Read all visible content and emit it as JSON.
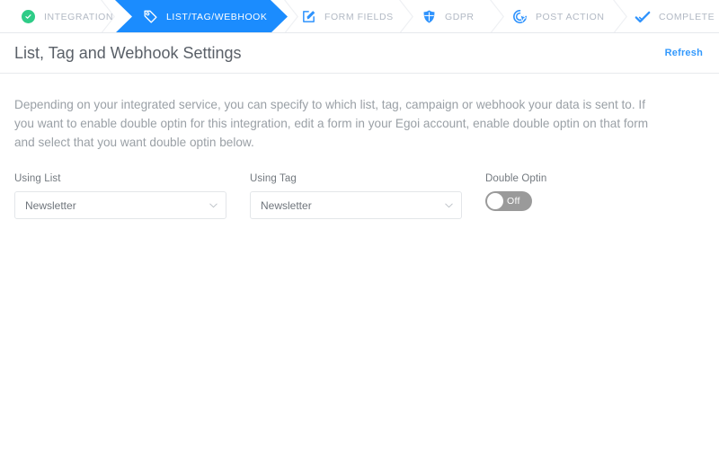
{
  "stepper": {
    "steps": [
      {
        "id": "integration",
        "label": "INTEGRATION",
        "icon": "green-check-circle-icon",
        "state": "done"
      },
      {
        "id": "list-tag-webhook",
        "label": "LIST/TAG/WEBHOOK",
        "icon": "tag-icon",
        "state": "active"
      },
      {
        "id": "form-fields",
        "label": "FORM FIELDS",
        "icon": "edit-pencil-square-icon",
        "state": "upcoming"
      },
      {
        "id": "gdpr",
        "label": "GDPR",
        "icon": "shield-icon",
        "state": "upcoming"
      },
      {
        "id": "post-action",
        "label": "POST ACTION",
        "icon": "cursor-click-icon",
        "state": "upcoming"
      },
      {
        "id": "complete",
        "label": "COMPLETE",
        "icon": "check-mark-icon",
        "state": "upcoming"
      }
    ]
  },
  "header": {
    "title": "List, Tag and Webhook Settings",
    "refresh_label": "Refresh"
  },
  "description": "Depending on your integrated service, you can specify to which list, tag, campaign or webhook your data is sent to. If you want to enable double optin for this integration, edit a form in your Egoi account, enable double optin on that form and select that you want double optin below.",
  "form": {
    "using_list": {
      "label": "Using List",
      "value": "Newsletter"
    },
    "using_tag": {
      "label": "Using Tag",
      "value": "Newsletter"
    },
    "double_optin": {
      "label": "Double Optin",
      "state_label": "Off",
      "enabled": false
    }
  },
  "colors": {
    "accent_blue": "#1b8cfe",
    "link_blue": "#3399fd",
    "done_green": "#2ecc87",
    "muted_text": "#9aa0a6",
    "toggle_off": "#9a9a9a"
  }
}
